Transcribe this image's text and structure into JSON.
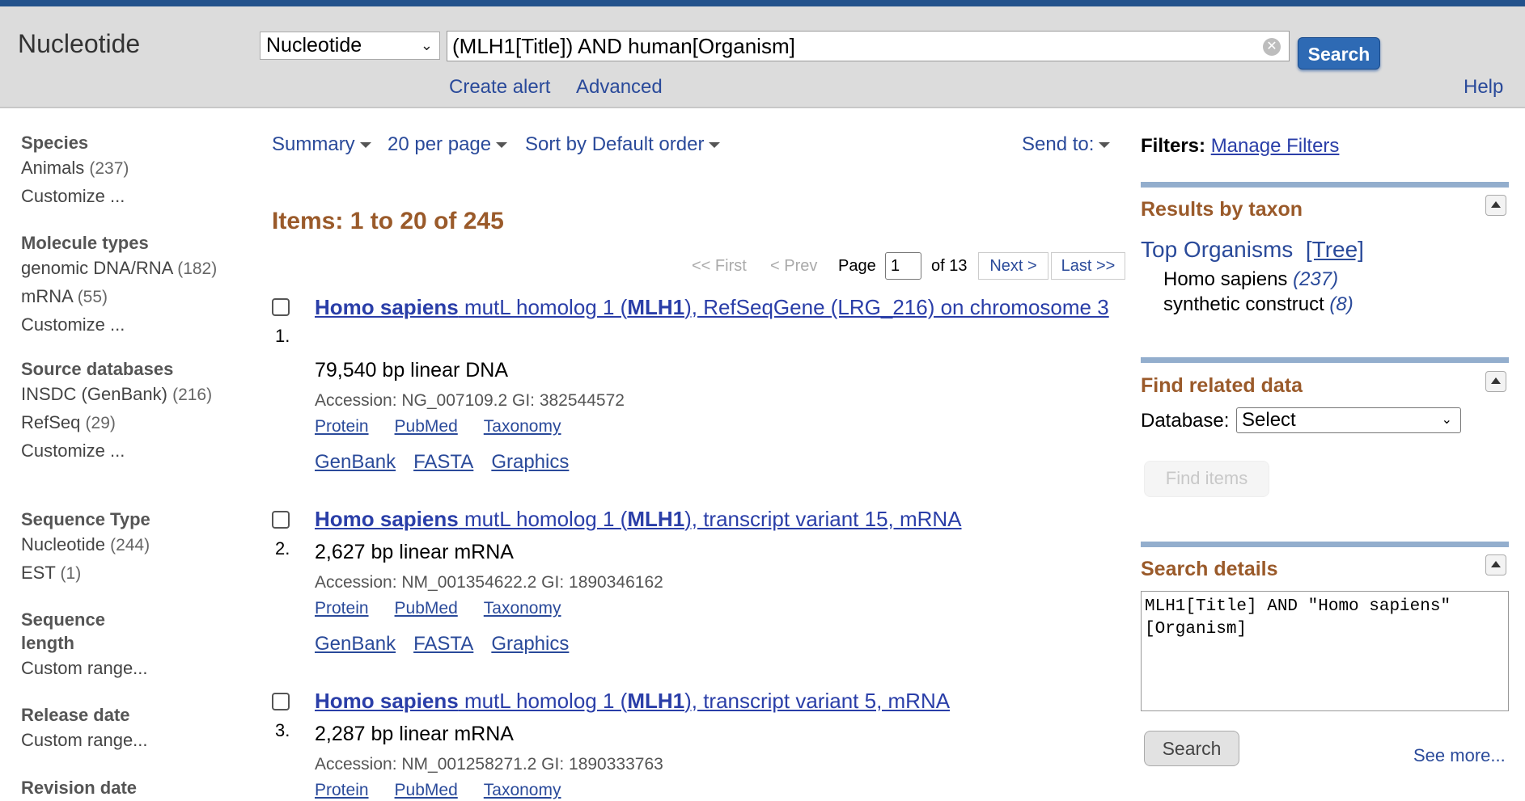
{
  "header": {
    "title": "Nucleotide",
    "db_select": "Nucleotide",
    "query": "(MLH1[Title]) AND human[Organism]",
    "search_label": "Search",
    "create_alert": "Create alert",
    "advanced": "Advanced",
    "help": "Help"
  },
  "facets": [
    {
      "title": "Species",
      "items": [
        {
          "label": "Animals",
          "count": "(237)"
        },
        {
          "label": "Customize ...",
          "count": ""
        }
      ]
    },
    {
      "title": "Molecule types",
      "items": [
        {
          "label": "genomic DNA/RNA",
          "count": "(182)"
        },
        {
          "label": "mRNA",
          "count": "(55)"
        },
        {
          "label": "Customize ...",
          "count": ""
        }
      ]
    },
    {
      "title": "Source databases",
      "items": [
        {
          "label": "INSDC (GenBank)",
          "count": "(216)"
        },
        {
          "label": "RefSeq",
          "count": "(29)"
        },
        {
          "label": "Customize ...",
          "count": ""
        }
      ]
    },
    {
      "title": "Sequence Type",
      "items": [
        {
          "label": "Nucleotide",
          "count": "(244)"
        },
        {
          "label": "EST",
          "count": "(1)"
        }
      ]
    },
    {
      "title": "Sequence length",
      "items": [
        {
          "label": "Custom range...",
          "count": ""
        }
      ]
    },
    {
      "title": "Release date",
      "items": [
        {
          "label": "Custom range...",
          "count": ""
        }
      ]
    },
    {
      "title": "Revision date",
      "items": []
    }
  ],
  "toolbar": {
    "summary": "Summary",
    "per_page": "20 per page",
    "sort": "Sort by Default order",
    "send_to": "Send to:"
  },
  "items_count": "Items: 1 to 20 of 245",
  "pager": {
    "first": "<< First",
    "prev": "< Prev",
    "page_label": "Page",
    "page_value": "1",
    "of": "of 13",
    "next": "Next >",
    "last": "Last >>"
  },
  "results": [
    {
      "num": "1.",
      "title_a": "Homo sapiens",
      "title_b": " mutL homolog 1 (",
      "title_c": "MLH1",
      "title_d": "), RefSeqGene (LRG_216) on chromosome 3",
      "desc": "79,540 bp linear DNA",
      "accession": "Accession: NG_007109.2   GI: 382544572",
      "links": [
        "Protein",
        "PubMed",
        "Taxonomy"
      ],
      "links2": [
        "GenBank",
        "FASTA",
        "Graphics"
      ]
    },
    {
      "num": "2.",
      "title_a": "Homo sapiens",
      "title_b": " mutL homolog 1 (",
      "title_c": "MLH1",
      "title_d": "), transcript variant 15, mRNA",
      "desc": "2,627 bp linear mRNA",
      "accession": "Accession: NM_001354622.2   GI: 1890346162",
      "links": [
        "Protein",
        "PubMed",
        "Taxonomy"
      ],
      "links2": [
        "GenBank",
        "FASTA",
        "Graphics"
      ]
    },
    {
      "num": "3.",
      "title_a": "Homo sapiens",
      "title_b": " mutL homolog 1 (",
      "title_c": "MLH1",
      "title_d": "), transcript variant 5, mRNA",
      "desc": "2,287 bp linear mRNA",
      "accession": "Accession: NM_001258271.2   GI: 1890333763",
      "links": [
        "Protein",
        "PubMed",
        "Taxonomy"
      ]
    }
  ],
  "right": {
    "filters_label": "Filters:",
    "manage_filters": "Manage Filters",
    "taxon_title": "Results by taxon",
    "top_organisms": "Top Organisms",
    "tree": "[Tree]",
    "taxa": [
      {
        "label": "Homo sapiens",
        "count": "(237)"
      },
      {
        "label": "synthetic construct",
        "count": "(8)"
      }
    ],
    "related_title": "Find related data",
    "database_label": "Database:",
    "database_select": "Select",
    "find_items": "Find items",
    "details_title": "Search details",
    "details_text": "MLH1[Title] AND \"Homo sapiens\"\n[Organism]",
    "details_search": "Search",
    "see_more": "See more..."
  }
}
